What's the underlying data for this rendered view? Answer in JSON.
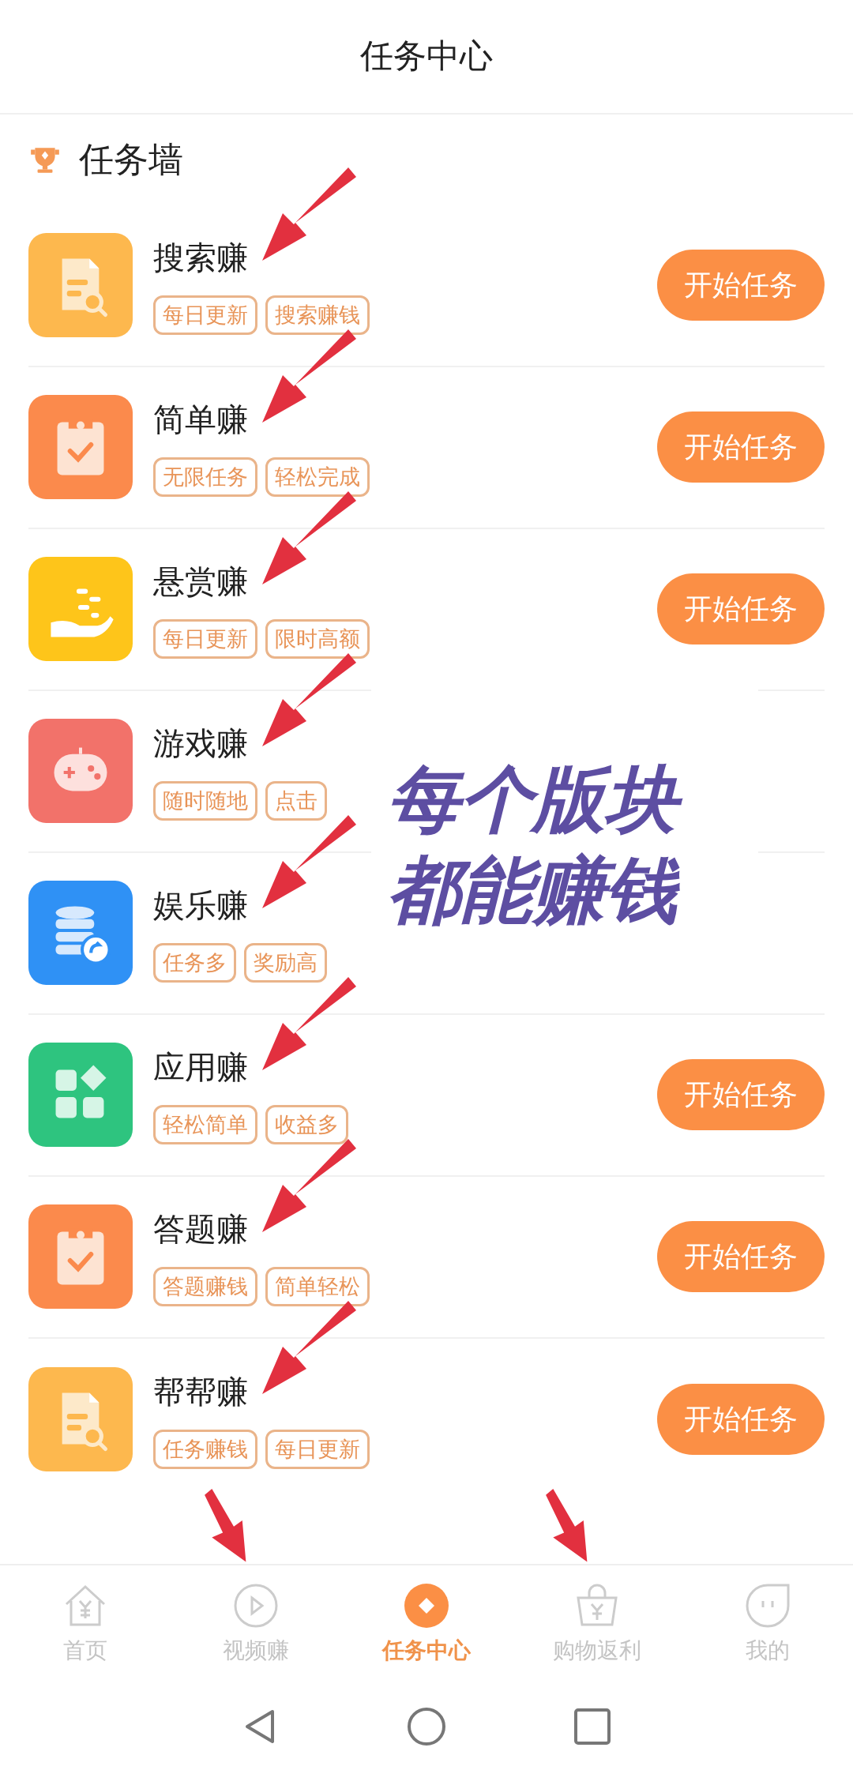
{
  "header": {
    "title": "任务中心"
  },
  "section": {
    "title": "任务墙"
  },
  "tasks": [
    {
      "kind": "search",
      "title": "搜索赚",
      "tags": [
        "每日更新",
        "搜索赚钱"
      ],
      "button": "开始任务",
      "annotated": true
    },
    {
      "kind": "clipboard",
      "title": "简单赚",
      "tags": [
        "无限任务",
        "轻松完成"
      ],
      "button": "开始任务",
      "annotated": true
    },
    {
      "kind": "reward",
      "title": "悬赏赚",
      "tags": [
        "每日更新",
        "限时高额"
      ],
      "button": "开始任务",
      "annotated": true
    },
    {
      "kind": "game",
      "title": "游戏赚",
      "tags": [
        "随时随地",
        "点击"
      ],
      "annotated": true
    },
    {
      "kind": "database",
      "title": "娱乐赚",
      "tags": [
        "任务多",
        "奖励高"
      ],
      "annotated": true
    },
    {
      "kind": "apps",
      "title": "应用赚",
      "tags": [
        "轻松简单",
        "收益多"
      ],
      "button": "开始任务",
      "annotated": true
    },
    {
      "kind": "clipboard",
      "title": "答题赚",
      "tags": [
        "答题赚钱",
        "简单轻松"
      ],
      "button": "开始任务",
      "annotated": true
    },
    {
      "kind": "search",
      "title": "帮帮赚",
      "tags": [
        "任务赚钱",
        "每日更新"
      ],
      "button": "开始任务",
      "annotated": true
    }
  ],
  "overlay": {
    "lines": [
      "每个版块",
      "都能赚钱"
    ]
  },
  "tabbar": [
    {
      "kind": "home",
      "label": "首页",
      "selected": false,
      "annotated": false
    },
    {
      "kind": "video",
      "label": "视频赚",
      "selected": false,
      "annotated": true
    },
    {
      "kind": "tasks",
      "label": "任务中心",
      "selected": true,
      "annotated": false
    },
    {
      "kind": "shop",
      "label": "购物返利",
      "selected": false,
      "annotated": true
    },
    {
      "kind": "me",
      "label": "我的",
      "selected": false,
      "annotated": false
    }
  ]
}
